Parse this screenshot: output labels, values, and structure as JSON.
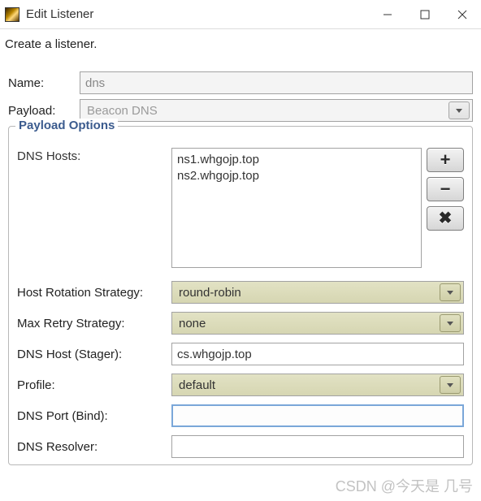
{
  "window": {
    "title": "Edit Listener"
  },
  "intro": "Create a listener.",
  "name": {
    "label": "Name:",
    "value": "dns"
  },
  "payload": {
    "label": "Payload:",
    "value": "Beacon DNS"
  },
  "fieldset": {
    "legend": "Payload Options",
    "dns_hosts": {
      "label": "DNS Hosts:",
      "items": [
        "ns1.whgojp.top",
        "ns2.whgojp.top"
      ]
    },
    "rotation": {
      "label": "Host Rotation Strategy:",
      "value": "round-robin"
    },
    "retry": {
      "label": "Max Retry Strategy:",
      "value": "none"
    },
    "stager": {
      "label": "DNS Host (Stager):",
      "value": "cs.whgojp.top"
    },
    "profile": {
      "label": "Profile:",
      "value": "default"
    },
    "port": {
      "label": "DNS Port (Bind):",
      "value": ""
    },
    "resolver": {
      "label": "DNS Resolver:",
      "value": ""
    }
  },
  "icons": {
    "add": "+",
    "remove": "−",
    "clear": "✖"
  },
  "watermark": "CSDN @今天是 几号"
}
